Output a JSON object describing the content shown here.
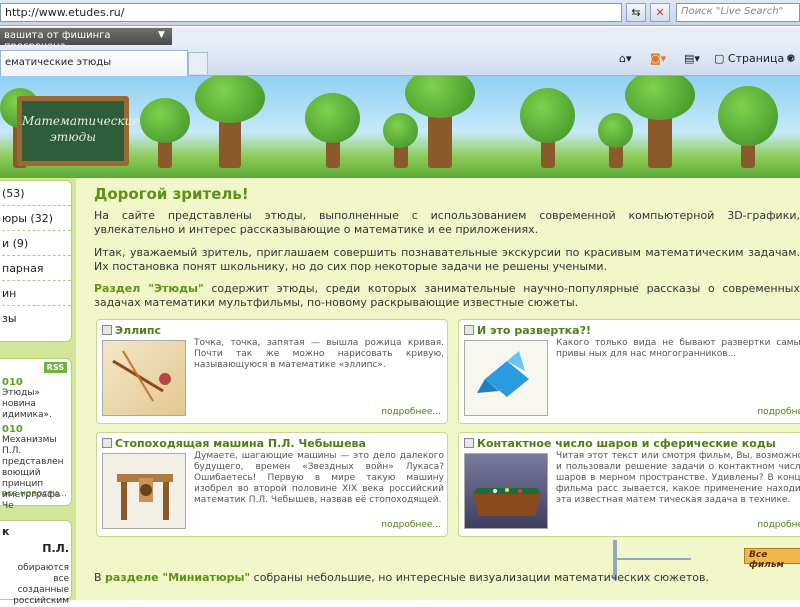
{
  "browser": {
    "address": "http://www.etudes.ru/",
    "search_placeholder": "Поиск \"Live Search\"",
    "phishing": "вашита от фишинга просрочена",
    "tab_label": "ематические этюды",
    "commands": {
      "page": "Страница"
    }
  },
  "banner": {
    "board_text_line1": "Математические",
    "board_text_line2": "этюды"
  },
  "sidebar": {
    "categories": [
      "(53)",
      "юры (32)",
      "и (9)",
      "парная",
      "ин",
      "зы"
    ],
    "rss": "RSS",
    "news": [
      {
        "date": "010",
        "text": "Этюды» новина идимика»."
      },
      {
        "date": "010",
        "text": "Механизмы П.Л. представлен воющий принцип иметрграфа Че"
      }
    ],
    "all_news": "все новости...",
    "bottom": {
      "line1": "к",
      "line2": "П.Л.",
      "text": "обираются все созданные российским"
    }
  },
  "main": {
    "heading": "Дорогой зритель!",
    "para1": "На сайте представлены этюды, выполненные с использованием современной компьютерной 3D-графики, увлекательно и интерес рассказывающие о математике и ее приложениях.",
    "para2": "Итак, уважаемый зритель, приглашаем совершить познавательные экскурсии по красивым математическим задачам. Их постановка понят школьнику, но до сих пор некоторые задачи не решены учеными.",
    "para3_bold": "Раздел \"Этюды\"",
    "para3": " содержит этюды, среди которых занимательные научно-популярные рассказы о современных задачах математики мультфильмы, по-новому раскрывающие известные сюжеты.",
    "cards": [
      {
        "title": "Эллипс",
        "text": "Точка, точка, запятая — вышла рожица кривая. Почти так же можно нарисовать кривую, называющуюся в математике «эллипс».",
        "more": "подробнее..."
      },
      {
        "title": "И это развертка?!",
        "text": "Какого только вида не бывают развертки самых привы ных для нас многогранников...",
        "more": "подробне"
      },
      {
        "title": "Стопоходящая машина П.Л. Чебышева",
        "text": "Думаете, шагающие машины — это дело далекого будущего, времен «Звездных войн» Лукаса? Ошибаетесь! Первую в мире такую машину изобрел во второй половине XIX века российский математик П.Л. Чебышев, назвав её стопоходящей.",
        "more": "подробнее..."
      },
      {
        "title": "Контактное число шаров и сферические коды",
        "text": "Читая этот текст или смотря фильм, Вы, возможно, и пользовали решение задачи о контактном числе шаров в мерном пространстве. Удивлены? В конце фильма расс зывается, какое применение находит эта известная матем тическая задача в технике.",
        "more": "подробне"
      }
    ],
    "all_films": "Все фильм",
    "footer_pre": "В ",
    "footer_bold": "разделе \"Миниатюры\"",
    "footer_post": " собраны небольшие, но интересные визуализации математических сюжетов."
  }
}
